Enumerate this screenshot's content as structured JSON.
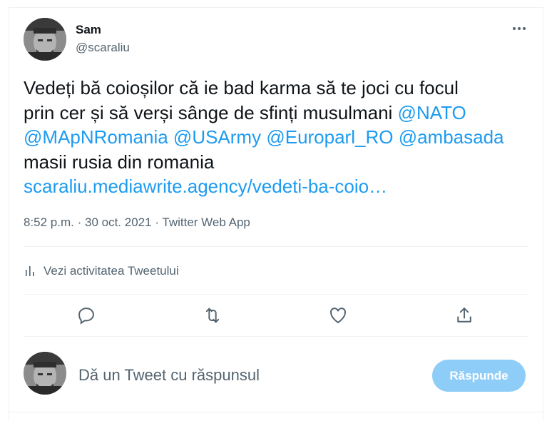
{
  "tweet": {
    "author_name": "Sam",
    "author_handle": "@scaraliu",
    "text_line_1": "Vedeți bă coioșilor că ie bad karma să te joci cu focul",
    "text_line_2": "prin cer și să verși sânge de sfinți musulmani ",
    "mention_nato": "@NATO",
    "mention_mapn": "@MApNRomania",
    "mention_usarmy": "@USArmy",
    "mention_europarl": "@Europarl_RO",
    "mention_ambasada": "@ambasada",
    "text_line_4": "masii rusia din romania",
    "url": "scaraliu.mediawrite.agency/vedeti-ba-coio…",
    "time": "8:52 p.m.",
    "date": "30 oct. 2021",
    "app": "Twitter Web App"
  },
  "activity": {
    "label": "Vezi activitatea Tweetului"
  },
  "actions": {
    "icons": [
      "reply-icon",
      "retweet-icon",
      "like-icon",
      "share-icon"
    ]
  },
  "reply": {
    "placeholder": "Dă un Tweet cu răspunsul",
    "button_label": "Răspunde"
  },
  "colors": {
    "link": "#1d9bf0",
    "secondary_text": "#536471",
    "reply_button_disabled": "#8ecdf8"
  }
}
